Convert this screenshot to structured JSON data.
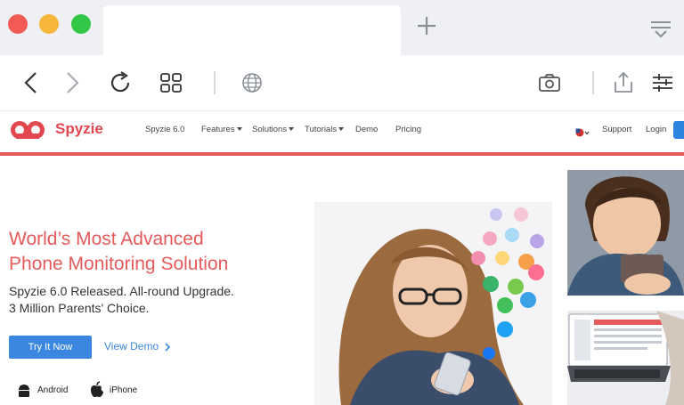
{
  "browser": {
    "traffic_lights": [
      "close",
      "minimize",
      "zoom"
    ],
    "colors": {
      "close": "#f25b55",
      "minimize": "#f6b63a",
      "zoom": "#33c748"
    },
    "toolbar_icons": [
      "back-icon",
      "forward-icon",
      "reload-icon",
      "grid-icon",
      "globe-icon",
      "camera-icon",
      "share-icon",
      "settings-sliders-icon"
    ]
  },
  "site": {
    "brand": "Spyzie",
    "nav": {
      "items": [
        "Spyzie 6.0",
        "Features",
        "Solutions",
        "Tutorials",
        "Demo",
        "Pricing"
      ],
      "support": "Support",
      "login": "Login"
    },
    "hero": {
      "title_line1": "World’s Most Advanced",
      "title_line2": "Phone Monitoring Solution",
      "sub_line1": "Spyzie 6.0 Released. All-round Upgrade.",
      "sub_line2": "3 Million Parents' Choice.",
      "cta": "Try It Now",
      "demo": "View Demo",
      "platforms": [
        "Android",
        "iPhone"
      ]
    },
    "accent": "#e55a5a",
    "button_blue": "#3a86e0"
  }
}
